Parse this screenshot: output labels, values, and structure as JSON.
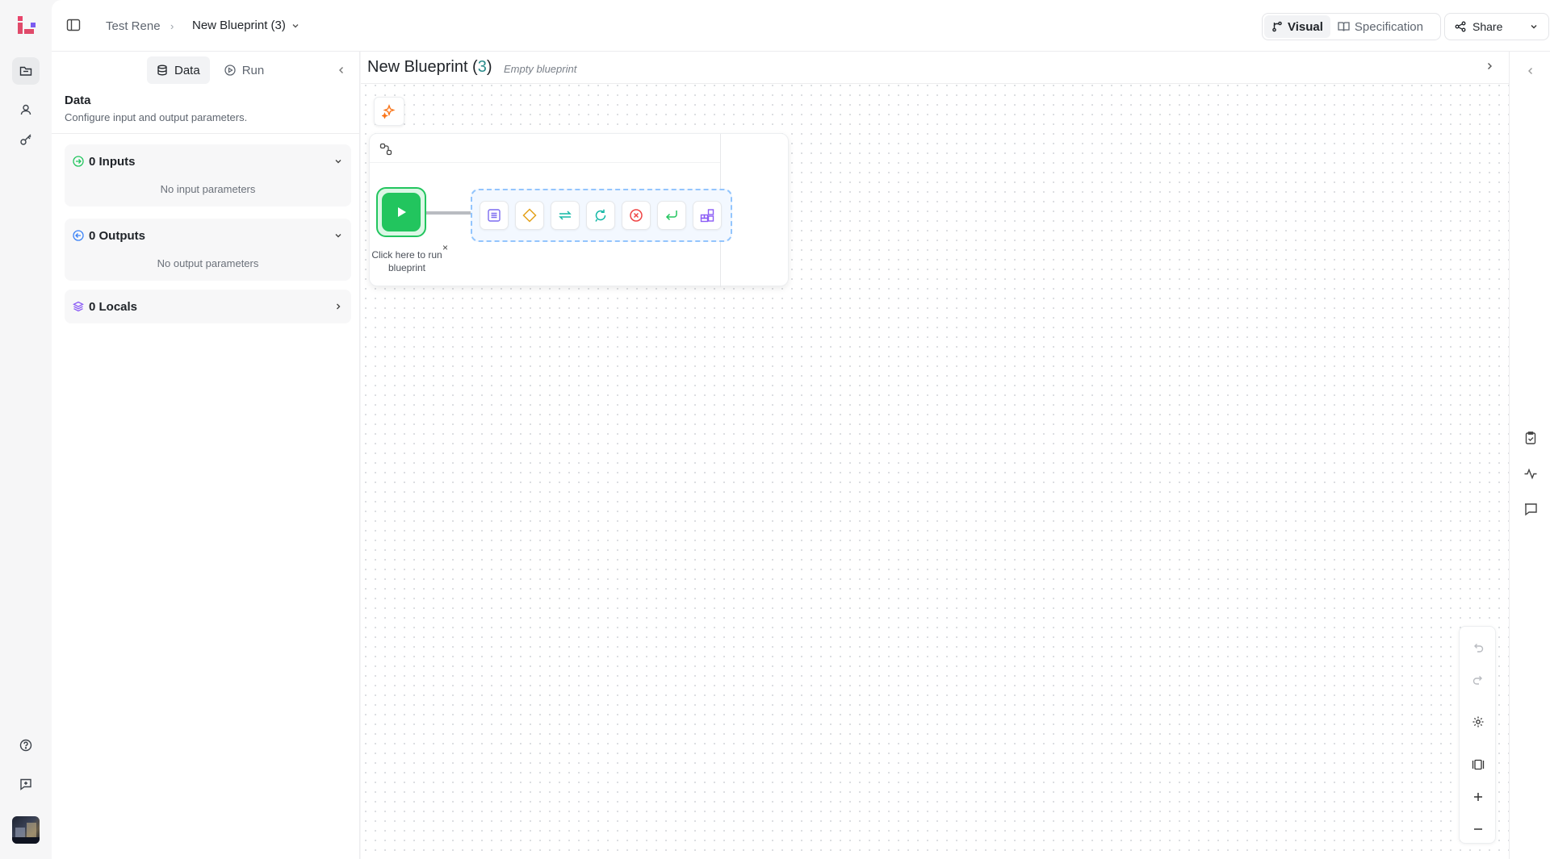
{
  "app": {
    "accent_color": "#e04a6a",
    "rail_icons": [
      "logo-icon",
      "blueprints-folder-icon",
      "user-icon",
      "key-icon",
      "help-icon",
      "feedback-icon"
    ]
  },
  "header": {
    "breadcrumb_workspace": "Test Rene",
    "breadcrumb_separator": "›",
    "blueprint_name": "New Blueprint (3)",
    "view_toggle": {
      "visual_label": "Visual",
      "specification_label": "Specification",
      "selected": "Visual"
    },
    "share_label": "Share"
  },
  "panel": {
    "tabs": [
      {
        "label": "Data",
        "selected": true
      },
      {
        "label": "Run",
        "selected": false
      }
    ],
    "title": "Data",
    "subtitle": "Configure input and output parameters.",
    "sections": {
      "inputs": {
        "label": "0 Inputs",
        "empty_text": "No input parameters",
        "color": "#22c55e",
        "expanded": true
      },
      "outputs": {
        "label": "0 Outputs",
        "empty_text": "No output parameters",
        "color": "#3b82f6",
        "expanded": true
      },
      "locals": {
        "label": "0 Locals",
        "color": "#8b5cf6",
        "expanded": false
      }
    }
  },
  "canvas": {
    "title_prefix": "New Blueprint (",
    "title_number": "3",
    "title_suffix": ")",
    "subtitle": "Empty blueprint",
    "run_hint": "Click here to run blueprint",
    "hint_close": "×",
    "run_color": "#22c55e",
    "palette_tools": [
      "note-icon",
      "condition-icon",
      "loop-icon",
      "retry-icon",
      "error-icon",
      "return-icon",
      "components-icon"
    ],
    "controls": [
      "undo-icon",
      "redo-icon",
      "settings-icon",
      "fit-view-icon",
      "zoom-in-icon",
      "zoom-out-icon"
    ]
  },
  "right_rail": {
    "icons": [
      "collapse-icon",
      "checklist-icon",
      "activity-icon",
      "comments-icon"
    ]
  }
}
